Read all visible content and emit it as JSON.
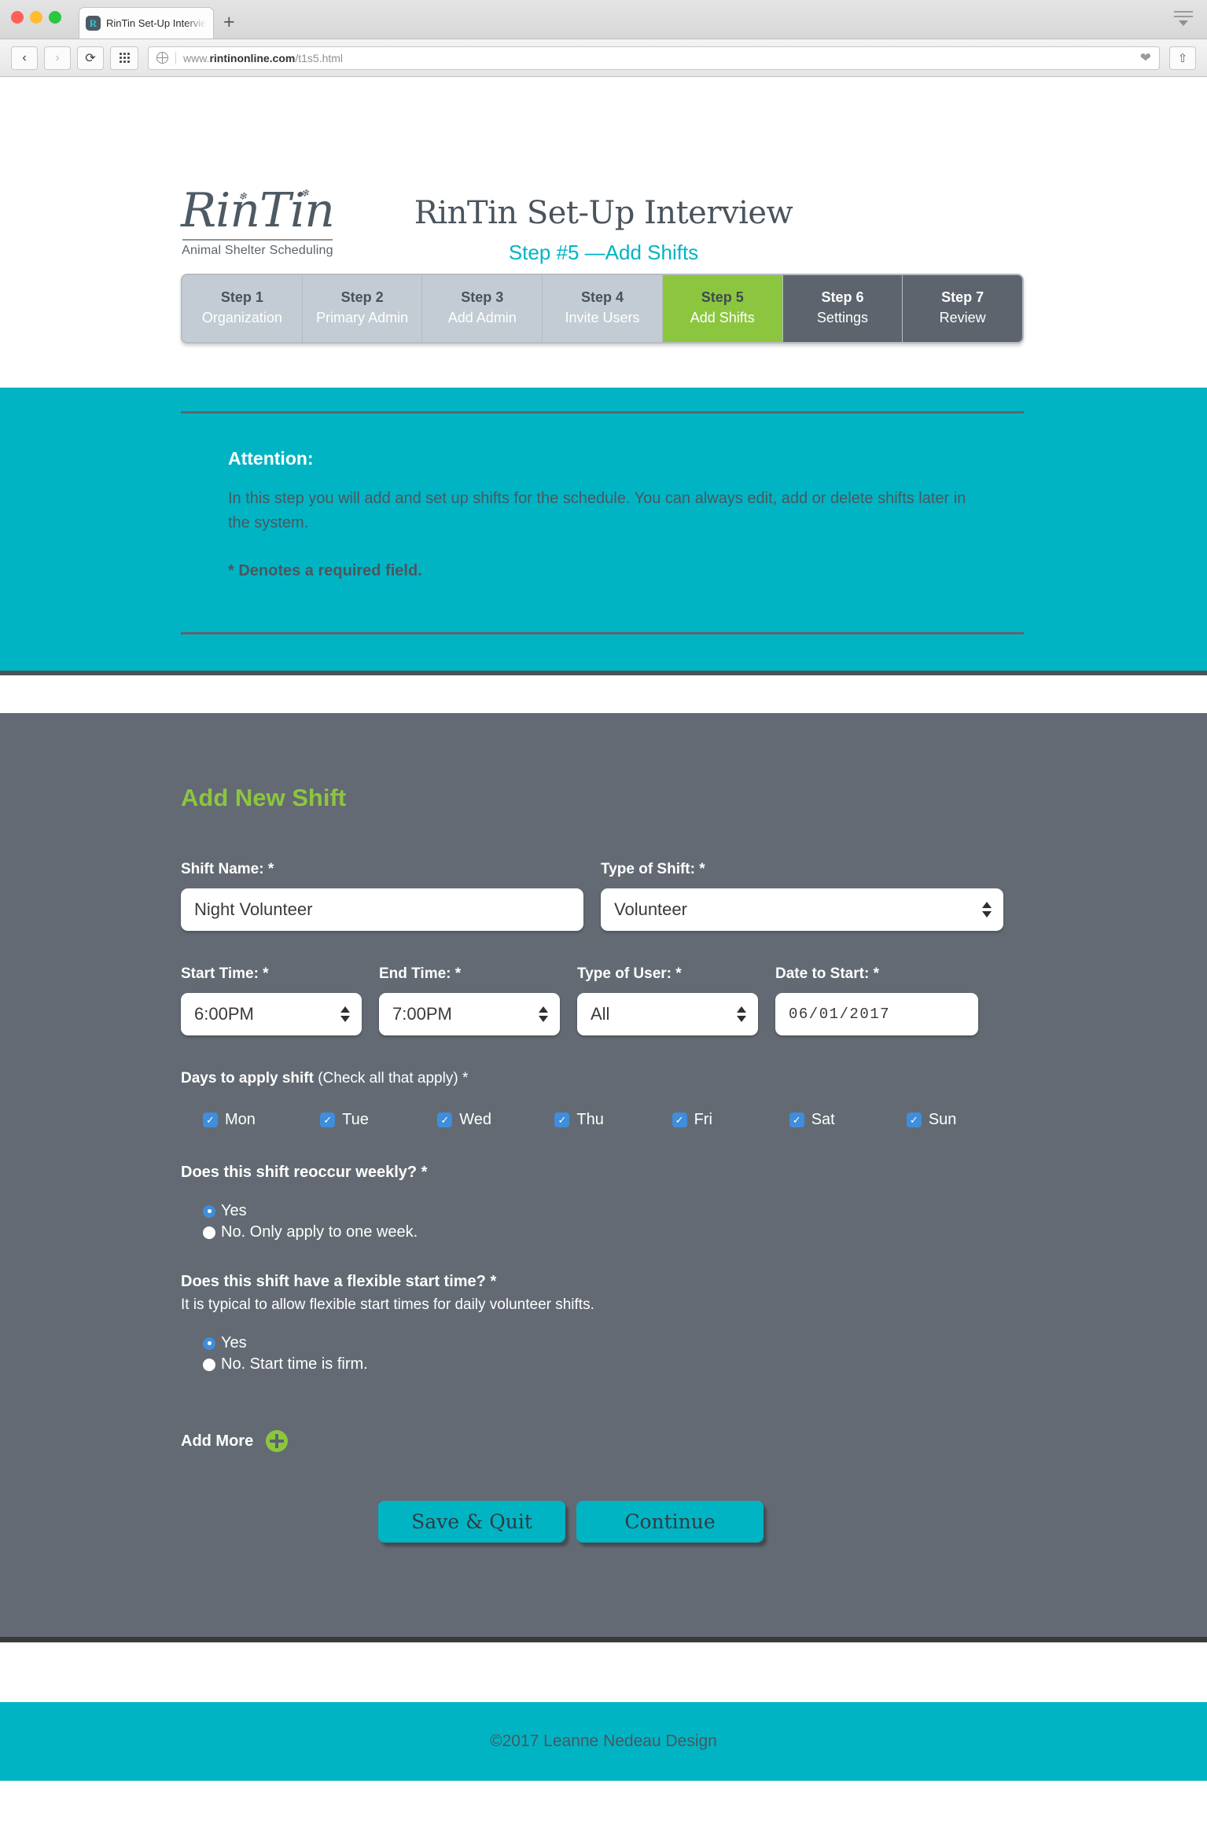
{
  "browser": {
    "tab_title": "RinTin Set-Up Interview | Step",
    "favicon_letter": "R",
    "new_tab_label": "+",
    "url_prefix": "www.",
    "url_domain": "rintinonline.com",
    "url_path": "/t1s5.html",
    "back_label": "‹",
    "forward_label": "›",
    "reload_label": "⟳",
    "share_label": "⇧"
  },
  "header": {
    "logo_word": "RinTin",
    "logo_tagline": "Animal Shelter Scheduling",
    "title": "RinTin Set-Up Interview",
    "subtitle": "Step #5 —Add Shifts"
  },
  "steps": [
    {
      "num": "Step 1",
      "label": "Organization",
      "state": "done"
    },
    {
      "num": "Step 2",
      "label": "Primary Admin",
      "state": "done"
    },
    {
      "num": "Step 3",
      "label": "Add Admin",
      "state": "done"
    },
    {
      "num": "Step 4",
      "label": "Invite Users",
      "state": "done"
    },
    {
      "num": "Step 5",
      "label": "Add Shifts",
      "state": "current"
    },
    {
      "num": "Step 6",
      "label": "Settings",
      "state": "future"
    },
    {
      "num": "Step 7",
      "label": "Review",
      "state": "future"
    }
  ],
  "attention": {
    "heading": "Attention:",
    "body": "In this step you will add and set up shifts for the schedule. You can always edit, add or delete shifts later in the system.",
    "required_note": "* Denotes a required field."
  },
  "form": {
    "title": "Add New Shift",
    "shift_name": {
      "label": "Shift Name: *",
      "value": "Night Volunteer"
    },
    "type_of_shift": {
      "label": "Type of Shift: *",
      "value": "Volunteer"
    },
    "start_time": {
      "label": "Start Time: *",
      "value": "6:00PM"
    },
    "end_time": {
      "label": "End Time: *",
      "value": "7:00PM"
    },
    "type_of_user": {
      "label": "Type of User: *",
      "value": "All"
    },
    "date_to_start": {
      "label": "Date to Start: *",
      "value": "06/01/2017"
    },
    "days": {
      "label_bold": "Days to apply shift ",
      "label_sub": "(Check all that apply) *",
      "items": [
        {
          "label": "Mon",
          "checked": "✓"
        },
        {
          "label": "Tue",
          "checked": "✓"
        },
        {
          "label": "Wed",
          "checked": "✓"
        },
        {
          "label": "Thu",
          "checked": "✓"
        },
        {
          "label": "Fri",
          "checked": "✓"
        },
        {
          "label": "Sat",
          "checked": "✓"
        },
        {
          "label": "Sun",
          "checked": "✓"
        }
      ]
    },
    "reoccur": {
      "question": "Does this shift reoccur weekly? *",
      "option_yes": "Yes",
      "option_no": "No. Only apply to one week."
    },
    "flexible": {
      "question": "Does this shift have a flexible start time? *",
      "note": "It is typical to allow flexible start times for daily volunteer shifts.",
      "option_yes": "Yes",
      "option_no": "No. Start time is firm."
    },
    "add_more_label": "Add More",
    "save_quit_label": "Save & Quit",
    "continue_label": "Continue"
  },
  "footer": {
    "copyright": "©2017 Leanne Nedeau Design"
  },
  "colors": {
    "teal": "#00b4c4",
    "gray_panel": "#636a73",
    "green": "#8cc63e",
    "step_done": "#c3ccd4",
    "step_future": "#5d646d",
    "checkbox_blue": "#3f8ddb"
  }
}
